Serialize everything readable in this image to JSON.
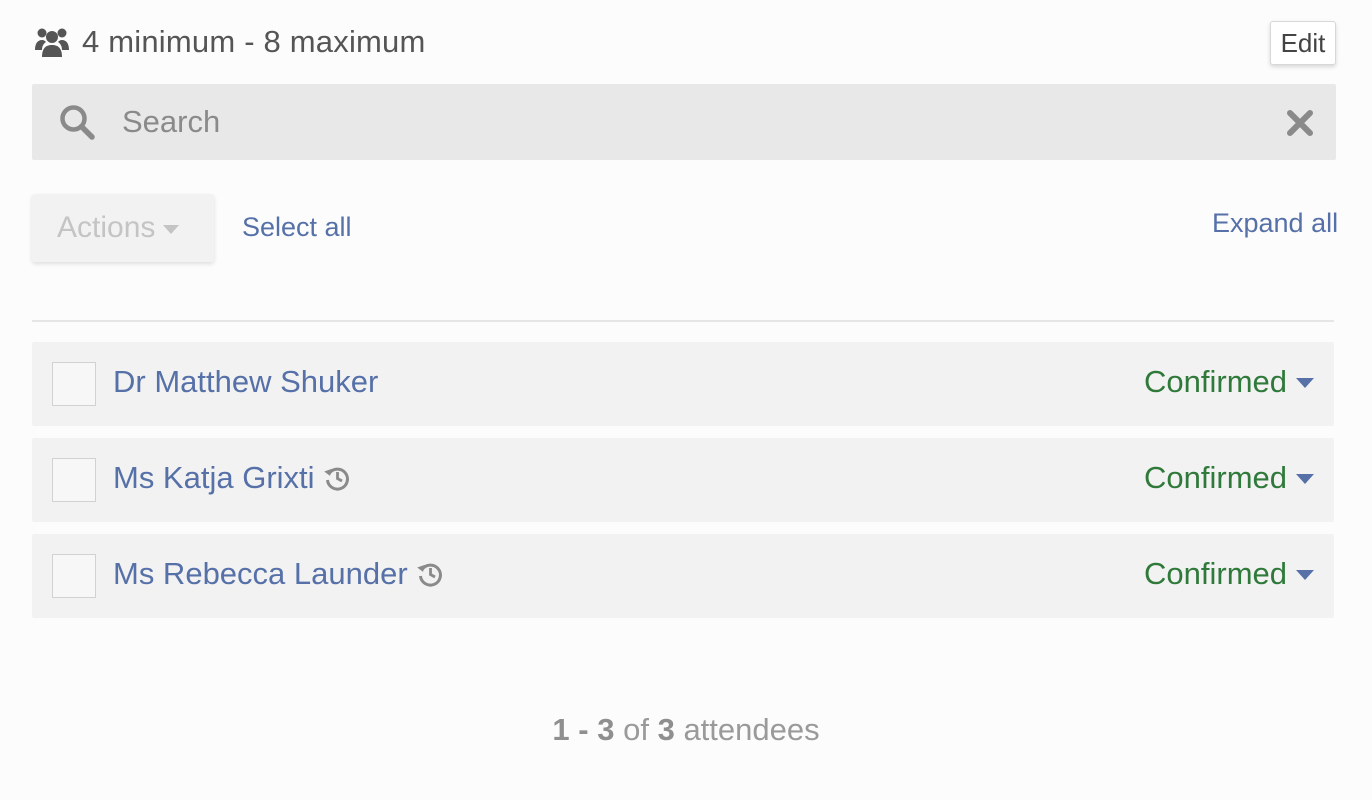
{
  "capacity": {
    "text": "4 minimum - 8 maximum",
    "icon": "users-icon"
  },
  "edit_button": {
    "label": "Edit"
  },
  "search": {
    "placeholder": "Search",
    "value": "",
    "icon": "search-icon",
    "clear_icon": "close-icon"
  },
  "toolbar": {
    "actions_label": "Actions",
    "select_all_label": "Select all",
    "expand_all_label": "Expand all"
  },
  "attendees": [
    {
      "name": "Dr Matthew Shuker",
      "status": "Confirmed",
      "has_history": false
    },
    {
      "name": "Ms Katja Grixti",
      "status": "Confirmed",
      "has_history": true
    },
    {
      "name": "Ms Rebecca Launder",
      "status": "Confirmed",
      "has_history": true
    }
  ],
  "pagination": {
    "start": "1",
    "dash": "-",
    "end": "3",
    "of": "of",
    "total": "3",
    "unit": "attendees"
  },
  "colors": {
    "link": "#5670a8",
    "status_confirmed": "#2f7a3a",
    "search_bg": "#e8e8e8",
    "row_bg": "#f2f2f2"
  }
}
